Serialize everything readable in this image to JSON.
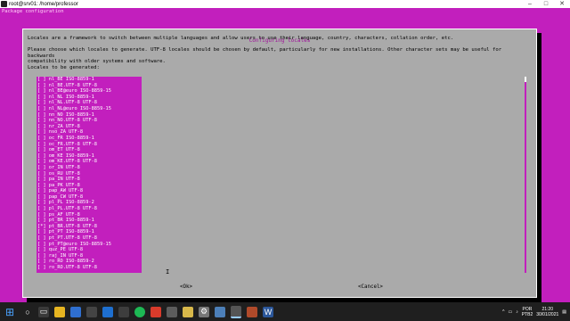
{
  "window": {
    "title": "root@srv01: /home/professor"
  },
  "terminal": {
    "package_config_label": "Package configuration"
  },
  "dialog": {
    "title": "Configuring locales",
    "paragraph1": "Locales are a framework to switch between multiple languages and allow users to use their language, country, characters, collation order, etc.",
    "paragraph2": "Please choose which locales to generate. UTF-8 locales should be chosen by default, particularly for new installations. Other character sets may be useful for backwards\ncompatibility with older systems and software.",
    "paragraph3": "Locales to be generated:",
    "locales": [
      "[ ] nl_BE ISO-8859-1",
      "[ ] nl_BE.UTF-8 UTF-8",
      "[ ] nl_BE@euro ISO-8859-15",
      "[ ] nl_NL ISO-8859-1",
      "[ ] nl_NL.UTF-8 UTF-8",
      "[ ] nl_NL@euro ISO-8859-15",
      "[ ] nn_NO ISO-8859-1",
      "[ ] nn_NO.UTF-8 UTF-8",
      "[ ] nr_ZA UTF-8",
      "[ ] nso_ZA UTF-8",
      "[ ] oc_FR ISO-8859-1",
      "[ ] oc_FR.UTF-8 UTF-8",
      "[ ] om_ET UTF-8",
      "[ ] om_KE ISO-8859-1",
      "[ ] om_KE.UTF-8 UTF-8",
      "[ ] or_IN UTF-8",
      "[ ] os_RU UTF-8",
      "[ ] pa_IN UTF-8",
      "[ ] pa_PK UTF-8",
      "[ ] pap_AW UTF-8",
      "[ ] pap_CW UTF-8",
      "[ ] pl_PL ISO-8859-2",
      "[ ] pl_PL.UTF-8 UTF-8",
      "[ ] ps_AF UTF-8",
      "[ ] pt_BR ISO-8859-1",
      "[*] pt_BR.UTF-8 UTF-8",
      "[ ] pt_PT ISO-8859-1",
      "[ ] pt_PT.UTF-8 UTF-8",
      "[ ] pt_PT@euro ISO-8859-15",
      "[ ] quz_PE UTF-8",
      "[ ] raj_IN UTF-8",
      "[ ] ro_RO ISO-8859-2",
      "[ ] ro_RO.UTF-8 UTF-8"
    ],
    "ok_label": "<Ok>",
    "cancel_label": "<Cancel>"
  },
  "taskbar": {
    "language": "POR",
    "layout": "PTB2",
    "time": "21:20",
    "date": "30/01/2021"
  }
}
